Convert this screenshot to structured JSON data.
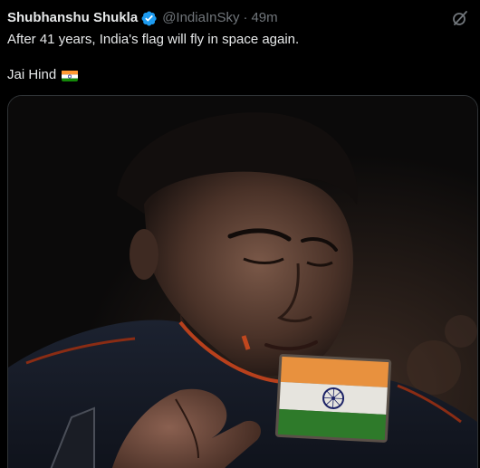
{
  "tweet": {
    "author": {
      "display_name": "Shubhanshu Shukla",
      "handle": "@IndiaInSky",
      "verified_icon": "verified-badge-icon"
    },
    "separator": "·",
    "timestamp": "49m",
    "text_line1": "After 41 years, India's flag will fly in space again.",
    "text_line2": "Jai Hind",
    "emoji": "india-flag-emoji",
    "grok_icon": "grok-icon",
    "media": {
      "description_icon": "photo",
      "accent_color": "#1d9bf0"
    }
  },
  "colors": {
    "background": "#000000",
    "text": "#e7e9ea",
    "secondary": "#71767b",
    "verified": "#1d9bf0",
    "saffron": "#ff9933",
    "india_green": "#138808",
    "chakra": "#000080"
  }
}
